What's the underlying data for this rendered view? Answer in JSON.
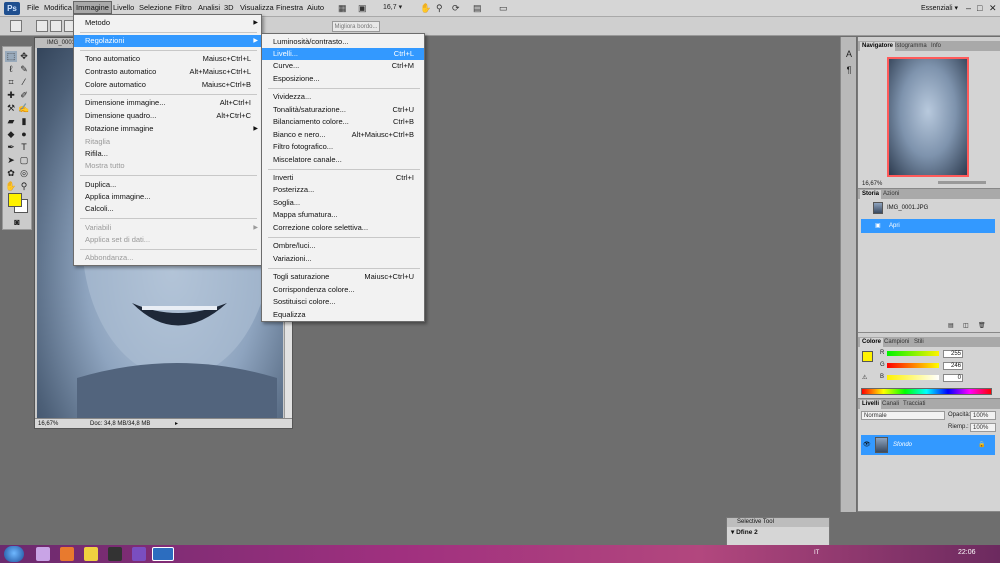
{
  "menubar": {
    "logo": "Ps",
    "items": [
      "File",
      "Modifica",
      "Immagine",
      "Livello",
      "Selezione",
      "Filtro",
      "Analisi",
      "3D",
      "Visualizza",
      "Finestra",
      "Aiuto"
    ],
    "zoom": "16,7",
    "workspace": "Essenziali"
  },
  "optionsbar": {
    "refine_edge": "Migliora bordo..."
  },
  "document": {
    "title": "IMG_0001.JPG",
    "zoom": "16,67%",
    "doc_info": "Doc: 34,8 MB/34,8 MB"
  },
  "image_menu": {
    "items": [
      {
        "label": "Metodo",
        "shortcut": "",
        "submenu": true,
        "disabled": false
      },
      {
        "label": "Regolazioni",
        "shortcut": "",
        "submenu": true,
        "disabled": false,
        "highlighted": true
      },
      {
        "label": "Tono automatico",
        "shortcut": "Maiusc+Ctrl+L",
        "disabled": false
      },
      {
        "label": "Contrasto automatico",
        "shortcut": "Alt+Maiusc+Ctrl+L",
        "disabled": false
      },
      {
        "label": "Colore automatico",
        "shortcut": "Maiusc+Ctrl+B",
        "disabled": false
      },
      {
        "label": "Dimensione immagine...",
        "shortcut": "Alt+Ctrl+I",
        "disabled": false
      },
      {
        "label": "Dimensione quadro...",
        "shortcut": "Alt+Ctrl+C",
        "disabled": false
      },
      {
        "label": "Rotazione immagine",
        "shortcut": "",
        "submenu": true,
        "disabled": false
      },
      {
        "label": "Ritaglia",
        "shortcut": "",
        "disabled": true
      },
      {
        "label": "Rifila...",
        "shortcut": "",
        "disabled": false
      },
      {
        "label": "Mostra tutto",
        "shortcut": "",
        "disabled": true
      },
      {
        "label": "Duplica...",
        "shortcut": "",
        "disabled": false
      },
      {
        "label": "Applica immagine...",
        "shortcut": "",
        "disabled": false
      },
      {
        "label": "Calcoli...",
        "shortcut": "",
        "disabled": false
      },
      {
        "label": "Variabili",
        "shortcut": "",
        "submenu": true,
        "disabled": true
      },
      {
        "label": "Applica set di dati...",
        "shortcut": "",
        "disabled": true
      },
      {
        "label": "Abbondanza...",
        "shortcut": "",
        "disabled": true
      }
    ]
  },
  "adjust_menu": {
    "items": [
      {
        "label": "Luminosità/contrasto...",
        "shortcut": ""
      },
      {
        "label": "Livelli...",
        "shortcut": "Ctrl+L",
        "highlighted": true
      },
      {
        "label": "Curve...",
        "shortcut": "Ctrl+M"
      },
      {
        "label": "Esposizione...",
        "shortcut": ""
      },
      {
        "label": "Vividezza...",
        "shortcut": ""
      },
      {
        "label": "Tonalità/saturazione...",
        "shortcut": "Ctrl+U"
      },
      {
        "label": "Bilanciamento colore...",
        "shortcut": "Ctrl+B"
      },
      {
        "label": "Bianco e nero...",
        "shortcut": "Alt+Maiusc+Ctrl+B"
      },
      {
        "label": "Filtro fotografico...",
        "shortcut": ""
      },
      {
        "label": "Miscelatore canale...",
        "shortcut": ""
      },
      {
        "label": "Inverti",
        "shortcut": "Ctrl+I"
      },
      {
        "label": "Posterizza...",
        "shortcut": ""
      },
      {
        "label": "Soglia...",
        "shortcut": ""
      },
      {
        "label": "Mappa sfumatura...",
        "shortcut": ""
      },
      {
        "label": "Correzione colore selettiva...",
        "shortcut": ""
      },
      {
        "label": "Ombre/luci...",
        "shortcut": ""
      },
      {
        "label": "Variazioni...",
        "shortcut": ""
      },
      {
        "label": "Togli saturazione",
        "shortcut": "Maiusc+Ctrl+U"
      },
      {
        "label": "Corrispondenza colore...",
        "shortcut": ""
      },
      {
        "label": "Sostituisci colore...",
        "shortcut": ""
      },
      {
        "label": "Equalizza",
        "shortcut": ""
      }
    ]
  },
  "navigator": {
    "tabs": [
      "Navigatore",
      "Istogramma",
      "Info"
    ],
    "zoom": "16,67%"
  },
  "history": {
    "tabs": [
      "Storia",
      "Azioni"
    ],
    "snapshot": "IMG_0001.JPG",
    "state": "Apri"
  },
  "color": {
    "tabs": [
      "Colore",
      "Campioni",
      "Stili"
    ],
    "channels": [
      {
        "name": "R",
        "value": "255"
      },
      {
        "name": "G",
        "value": "246"
      },
      {
        "name": "B",
        "value": "0"
      }
    ],
    "foreground": "#fff200"
  },
  "layers": {
    "tabs": [
      "Livelli",
      "Canali",
      "Tracciati"
    ],
    "blend_mode": "Normale",
    "opacity_label": "Opacità:",
    "opacity": "100%",
    "fill_label": "Riemp.:",
    "fill": "100%",
    "layer_name": "Sfondo"
  },
  "selective_tool": {
    "title": "Selective Tool",
    "item": "Dfine 2"
  },
  "taskbar": {
    "lang": "IT",
    "time": "22:06"
  },
  "colors": {
    "highlight": "#3399ff",
    "menubar": "#d6d6d6",
    "workspace": "#6e6e6e"
  }
}
